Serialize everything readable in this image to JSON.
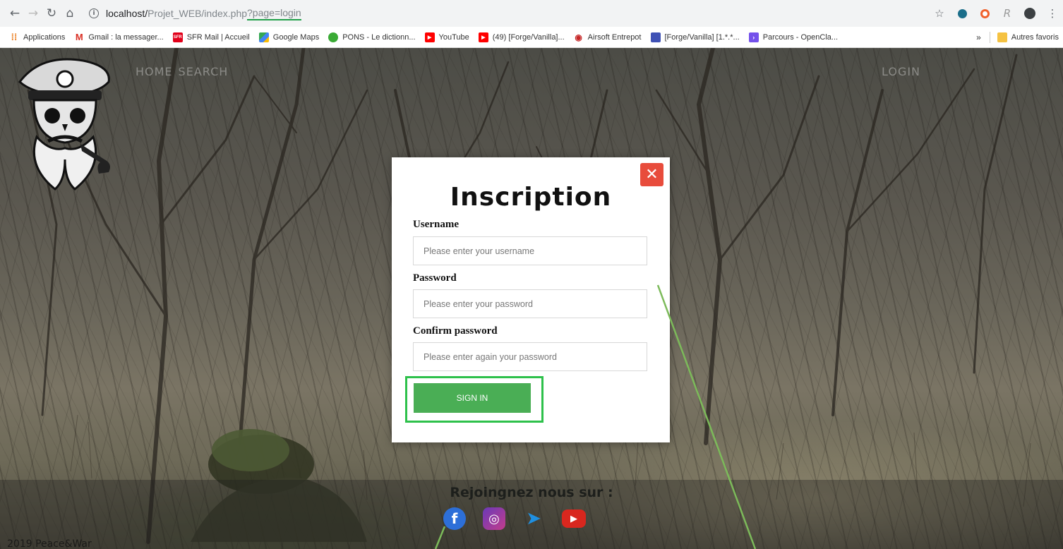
{
  "browser": {
    "url_host": "localhost/",
    "url_path": "Projet_WEB/index.php",
    "url_query": "?page=login"
  },
  "bookmarks": [
    {
      "label": "Applications",
      "icon": "apps-grid-icon",
      "color": "#e8710a"
    },
    {
      "label": "Gmail : la messager...",
      "icon": "gmail-icon",
      "color": "#d93025"
    },
    {
      "label": "SFR Mail | Accueil",
      "icon": "sfr-icon",
      "color": "#e2001a"
    },
    {
      "label": "Google Maps",
      "icon": "maps-icon",
      "color": "#34a853"
    },
    {
      "label": "PONS - Le dictionn...",
      "icon": "pons-icon",
      "color": "#3aaa35"
    },
    {
      "label": "YouTube",
      "icon": "youtube-icon",
      "color": "#ff0000"
    },
    {
      "label": "(49) [Forge/Vanilla]...",
      "icon": "youtube-icon",
      "color": "#ff0000"
    },
    {
      "label": "Airsoft Entrepot",
      "icon": "target-icon",
      "color": "#c62828"
    },
    {
      "label": "[Forge/Vanilla] [1.*.*...",
      "icon": "page-icon",
      "color": "#3f51b5"
    },
    {
      "label": "Parcours - OpenCla...",
      "icon": "openclassrooms-icon",
      "color": "#7451eb"
    }
  ],
  "bookmarks_more": "»",
  "bookmarks_other": "Autres favoris",
  "site": {
    "nav": [
      "HOME",
      "SEARCH"
    ],
    "login_link": "LOGIN",
    "footer_title": "Rejoingnez nous sur :",
    "copyright": "2019 Peace&War",
    "socials": [
      {
        "name": "facebook",
        "glyph": "f",
        "color": "#2d6fd8"
      },
      {
        "name": "instagram",
        "glyph": "◎",
        "color": "#9b3fb5"
      },
      {
        "name": "twitter",
        "glyph": "➤",
        "color": "#1f8fe0"
      },
      {
        "name": "youtube",
        "glyph": "▶",
        "color": "#d9271e"
      }
    ]
  },
  "modal": {
    "title": "Inscription",
    "close_glyph": "✕",
    "username_label": "Username",
    "username_placeholder": "Please enter your username",
    "password_label": "Password",
    "password_placeholder": "Please enter your password",
    "confirm_label": "Confirm password",
    "confirm_placeholder": "Please enter again your password",
    "submit_label": "SIGN IN"
  },
  "colors": {
    "accent_green": "#4aae55",
    "annotation_green": "#2ec14b",
    "close_red": "#e84c3c"
  }
}
